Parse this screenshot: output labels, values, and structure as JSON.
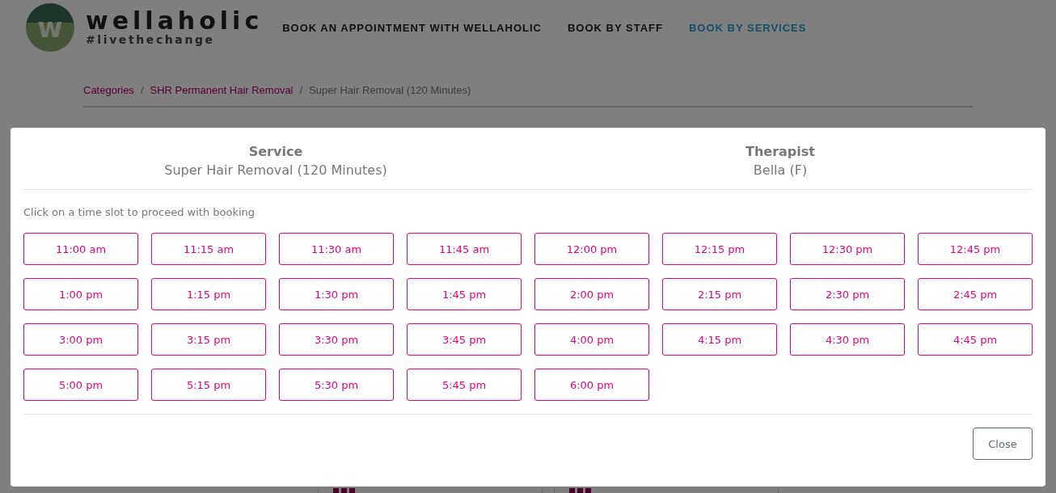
{
  "header": {
    "logo_letter": "w",
    "brand": "wellaholic",
    "tagline": "#livethechange",
    "nav": [
      {
        "label": "BOOK AN APPOINTMENT WITH WELLAHOLIC",
        "selected": false
      },
      {
        "label": "BOOK BY STAFF",
        "selected": false
      },
      {
        "label": "BOOK BY SERVICES",
        "selected": true
      }
    ]
  },
  "breadcrumb": [
    {
      "label": "Categories",
      "kind": "link"
    },
    {
      "label": "/",
      "kind": "separator"
    },
    {
      "label": "SHR Permanent Hair Removal",
      "kind": "link"
    },
    {
      "label": "/",
      "kind": "separator"
    },
    {
      "label": "Super Hair Removal (120 Minutes)",
      "kind": "current"
    }
  ],
  "modal": {
    "service_label": "Service",
    "service": "Super Hair Removal (120 Minutes)",
    "therapist_label": "Therapist",
    "therapist": "Bella (F)",
    "instruction": "Click on a time slot to proceed with booking",
    "slots": [
      "11:00 am",
      "11:15 am",
      "11:30 am",
      "11:45 am",
      "12:00 pm",
      "12:15 pm",
      "12:30 pm",
      "12:45 pm",
      "1:00 pm",
      "1:15 pm",
      "1:30 pm",
      "1:45 pm",
      "2:00 pm",
      "2:15 pm",
      "2:30 pm",
      "2:45 pm",
      "3:00 pm",
      "3:15 pm",
      "3:30 pm",
      "3:45 pm",
      "4:00 pm",
      "4:15 pm",
      "4:30 pm",
      "4:45 pm",
      "5:00 pm",
      "5:15 pm",
      "5:30 pm",
      "5:45 pm",
      "6:00 pm"
    ],
    "close": "Close"
  }
}
